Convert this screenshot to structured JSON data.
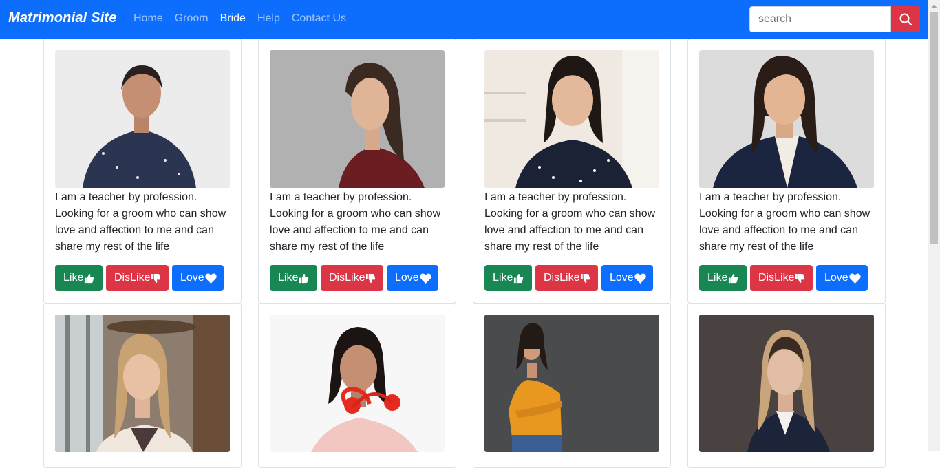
{
  "navbar": {
    "brand": "Matrimonial Site",
    "links": [
      {
        "label": "Home",
        "active": false
      },
      {
        "label": "Groom",
        "active": false
      },
      {
        "label": "Bride",
        "active": true
      },
      {
        "label": "Help",
        "active": false
      },
      {
        "label": "Contact Us",
        "active": false
      }
    ],
    "search_placeholder": "search",
    "search_icon": "search-icon"
  },
  "colors": {
    "primary": "#0d6efd",
    "success": "#198754",
    "danger": "#dc3545"
  },
  "cards": [
    {
      "bio": "I am a teacher by profession. Looking for a groom who can show love and affection to me and can share my rest of the life",
      "like_label": "Like",
      "dislike_label": "DisLike",
      "love_label": "Love"
    },
    {
      "bio": "I am a teacher by profession. Looking for a groom who can show love and affection to me and can share my rest of the life",
      "like_label": "Like",
      "dislike_label": "DisLike",
      "love_label": "Love"
    },
    {
      "bio": "I am a teacher by profession. Looking for a groom who can show love and affection to me and can share my rest of the life",
      "like_label": "Like",
      "dislike_label": "DisLike",
      "love_label": "Love"
    },
    {
      "bio": "I am a teacher by profession. Looking for a groom who can show love and affection to me and can share my rest of the life",
      "like_label": "Like",
      "dislike_label": "DisLike",
      "love_label": "Love"
    }
  ],
  "icons": {
    "like": "thumbs-up-icon",
    "dislike": "thumbs-down-icon",
    "love": "heart-icon"
  }
}
